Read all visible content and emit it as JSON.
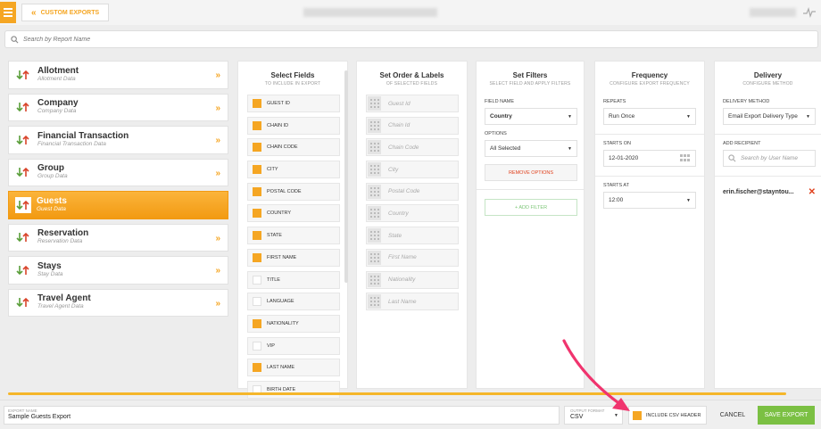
{
  "header": {
    "breadcrumb": "CUSTOM EXPORTS"
  },
  "search": {
    "placeholder": "Search by Report Name"
  },
  "report_types": [
    {
      "name": "Allotment",
      "sub": "Allotment Data",
      "active": false
    },
    {
      "name": "Company",
      "sub": "Company Data",
      "active": false
    },
    {
      "name": "Financial Transaction",
      "sub": "Financial Transaction Data",
      "active": false
    },
    {
      "name": "Group",
      "sub": "Group Data",
      "active": false
    },
    {
      "name": "Guests",
      "sub": "Guest Data",
      "active": true
    },
    {
      "name": "Reservation",
      "sub": "Reservation Data",
      "active": false
    },
    {
      "name": "Stays",
      "sub": "Stay Data",
      "active": false
    },
    {
      "name": "Travel Agent",
      "sub": "Travel Agent Data",
      "active": false
    }
  ],
  "select_fields": {
    "title": "Select Fields",
    "subtitle": "TO INCLUDE IN EXPORT",
    "items": [
      {
        "label": "GUEST ID",
        "checked": true
      },
      {
        "label": "CHAIN ID",
        "checked": true
      },
      {
        "label": "CHAIN CODE",
        "checked": true
      },
      {
        "label": "CITY",
        "checked": true
      },
      {
        "label": "POSTAL CODE",
        "checked": true
      },
      {
        "label": "COUNTRY",
        "checked": true
      },
      {
        "label": "STATE",
        "checked": true
      },
      {
        "label": "FIRST NAME",
        "checked": true
      },
      {
        "label": "TITLE",
        "checked": false
      },
      {
        "label": "LANGUAGE",
        "checked": false
      },
      {
        "label": "NATIONALITY",
        "checked": true
      },
      {
        "label": "VIP",
        "checked": false
      },
      {
        "label": "LAST NAME",
        "checked": true
      },
      {
        "label": "BIRTH DATE",
        "checked": false
      }
    ]
  },
  "order_labels": {
    "title": "Set Order & Labels",
    "subtitle": "OF SELECTED FIELDS",
    "items": [
      "Guest Id",
      "Chain Id",
      "Chain Code",
      "City",
      "Postal Code",
      "Country",
      "State",
      "First Name",
      "Nationality",
      "Last Name"
    ]
  },
  "filters": {
    "title": "Set Filters",
    "subtitle": "SELECT FIELD AND APPLY FILTERS",
    "field_name_label": "FIELD NAME",
    "field_name_value": "Country",
    "options_label": "OPTIONS",
    "options_value": "All Selected",
    "remove_label": "REMOVE OPTIONS",
    "add_filter_label": "+ ADD FILTER"
  },
  "frequency": {
    "title": "Frequency",
    "subtitle": "CONFIGURE EXPORT FREQUENCY",
    "repeats_label": "REPEATS",
    "repeats_value": "Run Once",
    "starts_on_label": "STARTS ON",
    "starts_on_value": "12-01-2020",
    "starts_at_label": "STARTS AT",
    "starts_at_value": "12:00"
  },
  "delivery": {
    "title": "Delivery",
    "subtitle": "CONFIGURE METHOD",
    "method_label": "DELIVERY METHOD",
    "method_value": "Email Export Delivery Type",
    "recipient_label": "ADD RECIPIENT",
    "recipient_placeholder": "Search by User Name",
    "recipient": "erin.fischer@stayntou..."
  },
  "footer": {
    "export_name_label": "EXPORT NAME",
    "export_name_value": "Sample Guests Export",
    "output_format_label": "OUTPUT FORMAT",
    "output_format_value": "CSV",
    "csv_header_label": "INCLUDE CSV HEADER",
    "csv_header_checked": true,
    "cancel_label": "CANCEL",
    "save_label": "SAVE EXPORT"
  },
  "colors": {
    "accent": "#f5a623",
    "save": "#7bc043",
    "remove": "#e0401c",
    "annotation_arrow": "#f0346e"
  }
}
